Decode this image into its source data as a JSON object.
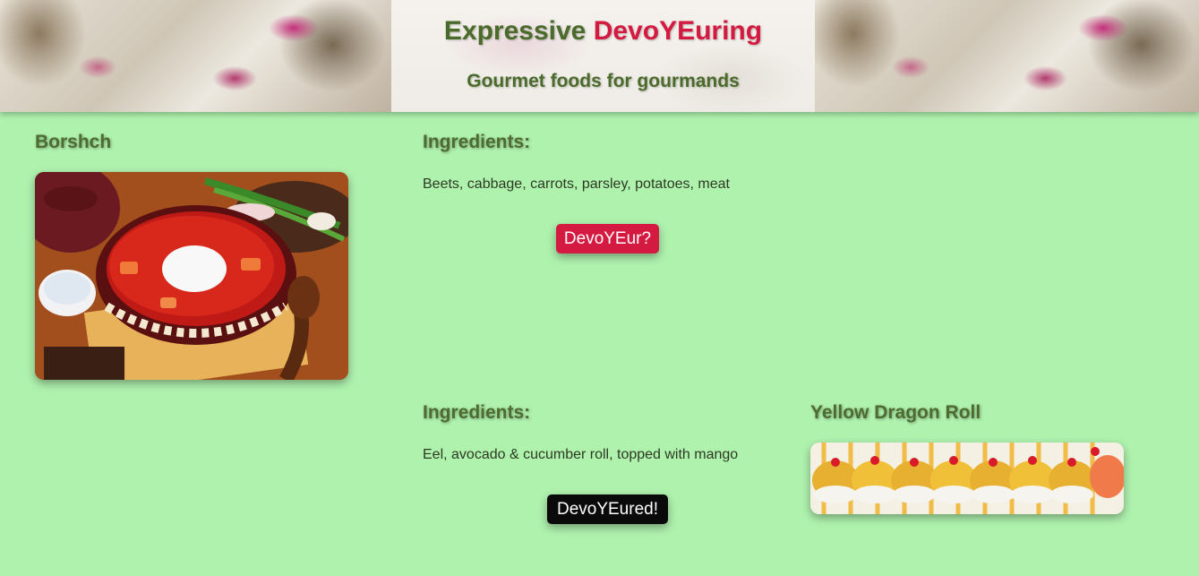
{
  "header": {
    "title_part1": "Expressive ",
    "title_part2": "DevoYEuring",
    "subtitle": "Gourmet foods for gourmands"
  },
  "dishes": [
    {
      "name": "Borshch",
      "ingredients_heading": "Ingredients:",
      "ingredients": "Beets, cabbage, carrots, parsley, potatoes, meat",
      "button_label": "DevoYEur?",
      "button_color": "#d41a40",
      "photo_icon": "borshch-photo"
    },
    {
      "name": "Yellow Dragon Roll",
      "ingredients_heading": "Ingredients:",
      "ingredients": "Eel, avocado & cucumber roll, topped with mango",
      "button_label": "DevoYEured!",
      "button_color": "#0a0a0a",
      "photo_icon": "sushi-roll-photo"
    }
  ],
  "colors": {
    "background": "#aff2ae",
    "heading_green": "#4e6b30",
    "accent_red": "#d41a40"
  }
}
